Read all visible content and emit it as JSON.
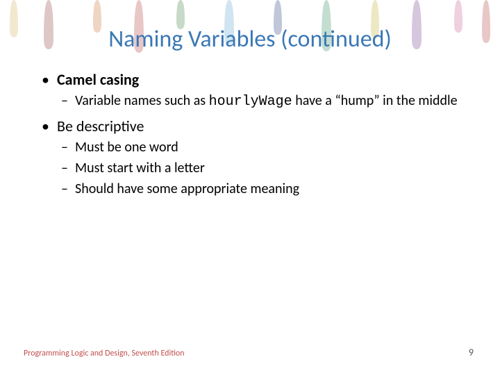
{
  "title": "Naming Variables (continued)",
  "bullets": {
    "b1": {
      "text": "Camel casing"
    },
    "b1_sub1_pre": "Variable names such as ",
    "b1_sub1_code": "hourlyWage",
    "b1_sub1_post": " have a “hump” in the middle",
    "b2": {
      "text": "Be descriptive"
    },
    "b2_sub1": "Must be one word",
    "b2_sub2": "Must start with a letter",
    "b2_sub3": "Should have some appropriate meaning"
  },
  "footer": {
    "left": "Programming Logic and Design, Seventh Edition",
    "page": "9"
  }
}
